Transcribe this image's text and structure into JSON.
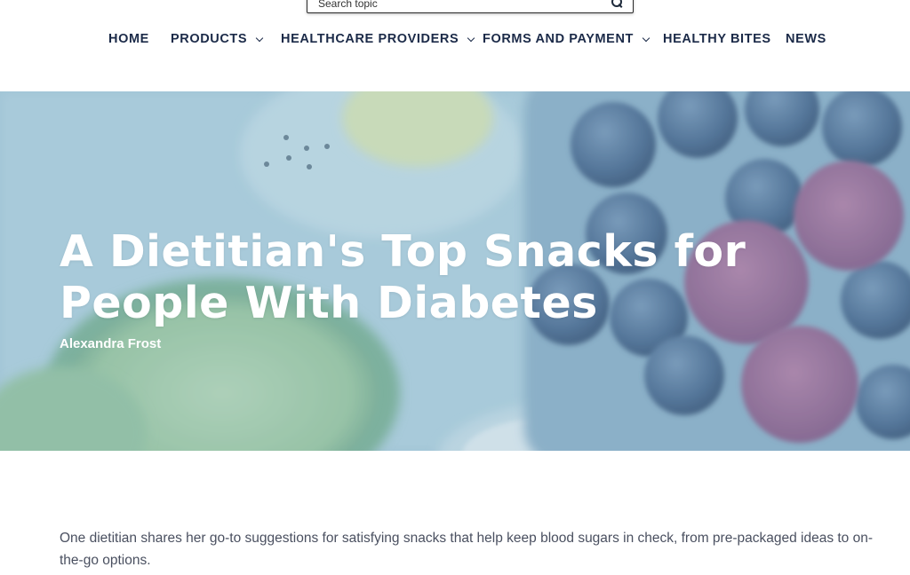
{
  "search": {
    "placeholder": "Search topic",
    "icon": "search-icon"
  },
  "nav": {
    "items": [
      {
        "label": "HOME",
        "has_dropdown": false
      },
      {
        "label": "PRODUCTS",
        "has_dropdown": true
      },
      {
        "label": "HEALTHCARE PROVIDERS",
        "has_dropdown": true
      },
      {
        "label": "FORMS AND PAYMENT",
        "has_dropdown": true
      },
      {
        "label": "HEALTHY BITES",
        "has_dropdown": false
      },
      {
        "label": "NEWS",
        "has_dropdown": false
      }
    ]
  },
  "hero": {
    "title": "A Dietitian's Top Snacks for People With Diabetes",
    "author": "Alexandra Frost"
  },
  "article": {
    "intro": "One dietitian shares her go-to suggestions for satisfying snacks that help keep blood sugars in check, from pre-packaged ideas to on-the-go options."
  },
  "colors": {
    "nav_text": "#1b2a48",
    "hero_tint": "#a7c8d8",
    "body_text": "#4a5060"
  }
}
